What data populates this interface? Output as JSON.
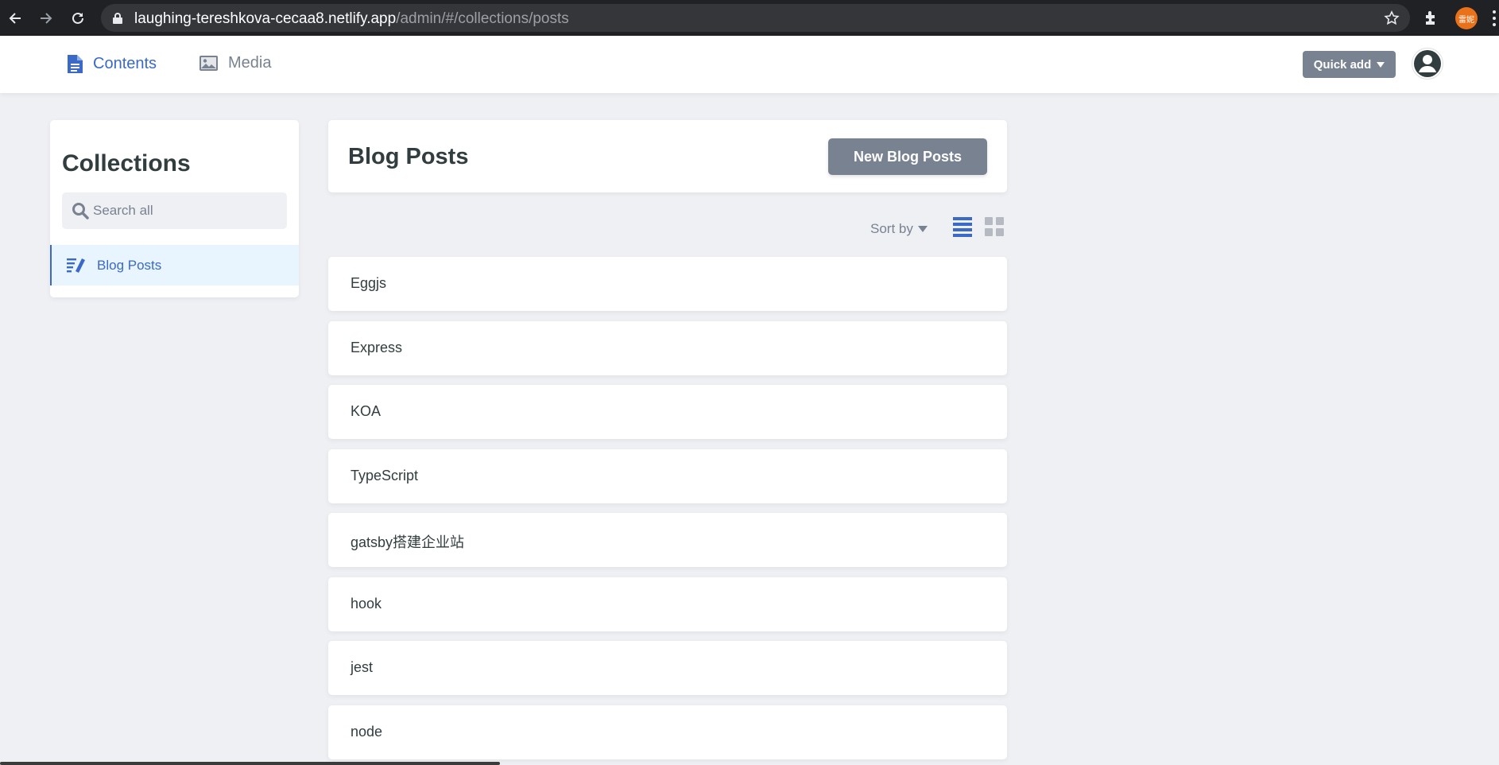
{
  "browser": {
    "url_host": "laughing-tereshkova-cecaa8.netlify.app",
    "url_path": "/admin/#/collections/posts",
    "profile_initials": "雷妮"
  },
  "header": {
    "nav": [
      {
        "label": "Contents",
        "icon": "document-icon",
        "active": true
      },
      {
        "label": "Media",
        "icon": "image-icon",
        "active": false
      }
    ],
    "quick_add_label": "Quick add"
  },
  "sidebar": {
    "title": "Collections",
    "search_placeholder": "Search all",
    "items": [
      {
        "label": "Blog Posts",
        "icon": "edit-list-icon",
        "active": true
      }
    ]
  },
  "main": {
    "title": "Blog Posts",
    "new_button_label": "New Blog Posts",
    "sort_label": "Sort by",
    "view_mode": "list",
    "entries": [
      "Eggjs",
      "Express",
      "KOA",
      "TypeScript",
      "gatsby搭建企业站",
      "hook",
      "jest",
      "node"
    ]
  },
  "colors": {
    "accent": "#3a69c7",
    "button_gray": "#798291",
    "background": "#eff0f4",
    "active_item_bg": "#e8f5fe"
  }
}
